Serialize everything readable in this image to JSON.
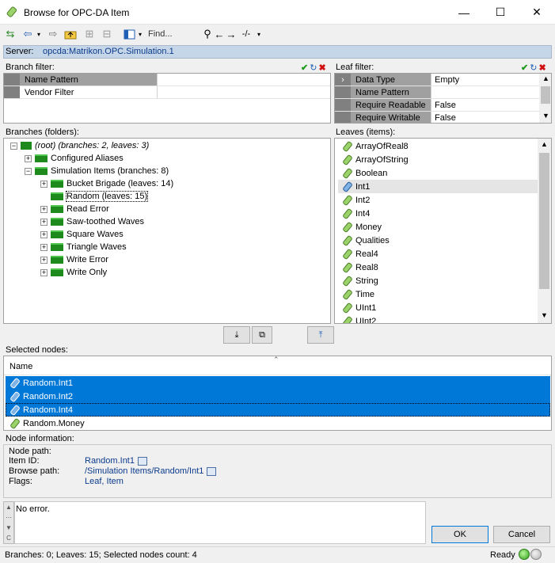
{
  "window": {
    "title": "Browse for OPC-DA Item",
    "minimize": "—",
    "maximize": "☐",
    "close": "✕"
  },
  "toolbar": {
    "find_label": "Find...",
    "find_option": "-/-"
  },
  "server": {
    "label": "Server:",
    "value": "opcda:Matrikon.OPC.Simulation.1"
  },
  "branch_filter": {
    "label": "Branch filter:",
    "rows": [
      {
        "name": "Name Pattern",
        "value": ""
      },
      {
        "name": "Vendor Filter",
        "value": ""
      }
    ]
  },
  "leaf_filter": {
    "label": "Leaf filter:",
    "rows": [
      {
        "name": "Data Type",
        "value": "Empty"
      },
      {
        "name": "Name Pattern",
        "value": ""
      },
      {
        "name": "Require Readable",
        "value": "False"
      },
      {
        "name": "Require Writable",
        "value": "False"
      }
    ]
  },
  "branches": {
    "label": "Branches (folders):",
    "root": "(root) (branches: 2, leaves: 3)",
    "configured_aliases": "Configured Aliases",
    "simulation_items": "Simulation Items (branches: 8)",
    "children": [
      "Bucket Brigade (leaves: 14)",
      "Random (leaves: 15)",
      "Read Error",
      "Saw-toothed Waves",
      "Square Waves",
      "Triangle Waves",
      "Write Error",
      "Write Only"
    ]
  },
  "leaves": {
    "label": "Leaves (items):",
    "items": [
      "ArrayOfReal8",
      "ArrayOfString",
      "Boolean",
      "Int1",
      "Int2",
      "Int4",
      "Money",
      "Qualities",
      "Real4",
      "Real8",
      "String",
      "Time",
      "UInt1",
      "UInt2"
    ]
  },
  "selected_nodes": {
    "label": "Selected nodes:",
    "column": "Name",
    "items": [
      "Random.Int1",
      "Random.Int2",
      "Random.Int4",
      "Random.Money"
    ]
  },
  "node_info": {
    "label": "Node information:",
    "node_path_label": "Node path:",
    "item_id_label": "Item ID:",
    "item_id": "Random.Int1",
    "browse_path_label": "Browse path:",
    "browse_path": "/Simulation Items/Random/Int1",
    "flags_label": "Flags:",
    "flags": "Leaf, Item"
  },
  "log": {
    "message": "No error."
  },
  "buttons": {
    "ok": "OK",
    "cancel": "Cancel"
  },
  "status": {
    "text": "Branches: 0; Leaves: 15; Selected nodes count: 4",
    "ready": "Ready"
  },
  "colors": {
    "selection": "#0078d7",
    "folder": "#1e8a1e",
    "server_bg": "#c5d6e8",
    "link": "#0b3a8c"
  }
}
